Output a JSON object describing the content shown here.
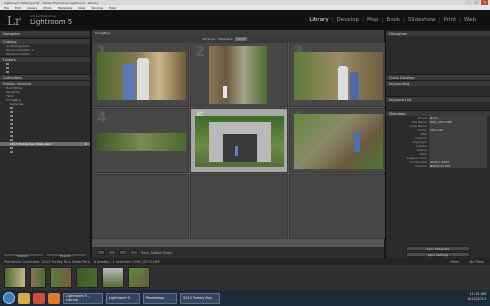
{
  "window": {
    "title": "Lightroom Catalog.lrcat - Adobe Photoshop Lightroom - Library"
  },
  "menu": [
    "File",
    "Edit",
    "Library",
    "Photo",
    "Metadata",
    "View",
    "Window",
    "Help"
  ],
  "brand": {
    "logo": "Lr",
    "small": "Adobe Photoshop",
    "big": "Lightroom 5"
  },
  "modules": [
    "Library",
    "Develop",
    "Map",
    "Book",
    "Slideshow",
    "Print",
    "Web"
  ],
  "left": {
    "navigator": "Navigator",
    "catalog": "Catalog",
    "catalog_items": [
      {
        "label": "All Photographs",
        "count": ""
      },
      {
        "label": "Quick Collection +",
        "count": ""
      },
      {
        "label": "Previous Import",
        "count": ""
      }
    ],
    "folders": "Folders",
    "collections": "Collections",
    "publish": "Publish Services",
    "publish_items": [
      "Hard Drive",
      "Facebook",
      "Flickr",
      "SmugMug"
    ],
    "galleries": [
      "2013 Turkey Run State Park",
      "Galleries"
    ],
    "sync": [
      "Import...",
      "Export..."
    ]
  },
  "center": {
    "publish_label": "SmugMug",
    "filter": [
      "Attribute",
      "Metadata",
      "None"
    ],
    "cell_numbers": [
      "1",
      "2",
      "3",
      "4",
      "5",
      "6",
      "",
      "",
      ""
    ],
    "sort_label": "Sort: Added Order"
  },
  "right": {
    "histogram": "Histogram",
    "quick": "Quick Develop",
    "keywording": "Keywording",
    "keyword_list": "Keyword List",
    "metadata": "Metadata",
    "metadata_fields": [
      {
        "k": "Preset",
        "v": "None"
      },
      {
        "k": "File Name",
        "v": "DSC_0071.NEF"
      },
      {
        "k": "Copy Name",
        "v": ""
      },
      {
        "k": "Folder",
        "v": "2013-08"
      },
      {
        "k": "Title",
        "v": ""
      },
      {
        "k": "Caption",
        "v": ""
      },
      {
        "k": "Copyright",
        "v": ""
      },
      {
        "k": "Creator",
        "v": ""
      },
      {
        "k": "Rating",
        "v": ""
      },
      {
        "k": "Label",
        "v": ""
      },
      {
        "k": "Capture Time",
        "v": ""
      },
      {
        "k": "Dimensions",
        "v": "4928 x 3264"
      },
      {
        "k": "Camera",
        "v": "NIKON D7000"
      }
    ],
    "sync_buttons": [
      "Sync Metadata",
      "Sync Settings"
    ]
  },
  "filmstrip": {
    "path": "Published Collection: 2013 Turkey Run State Park",
    "info": "6 photos / 1 selected / DSC_0071.NEF",
    "filter_label": "Filter:",
    "filter_value": "No Filter"
  },
  "taskbar": {
    "tasks": [
      "Lightroom 5 - Library",
      "Lightroom 5",
      "Photoshop",
      "2013 Turkey Run"
    ],
    "time": "11:15 AM",
    "date": "8/12/2013"
  },
  "colors": {
    "accent": "#3b7bbf",
    "panel": "#2b2b2b",
    "grid": "#555555",
    "selected": "#a9a9a9"
  }
}
